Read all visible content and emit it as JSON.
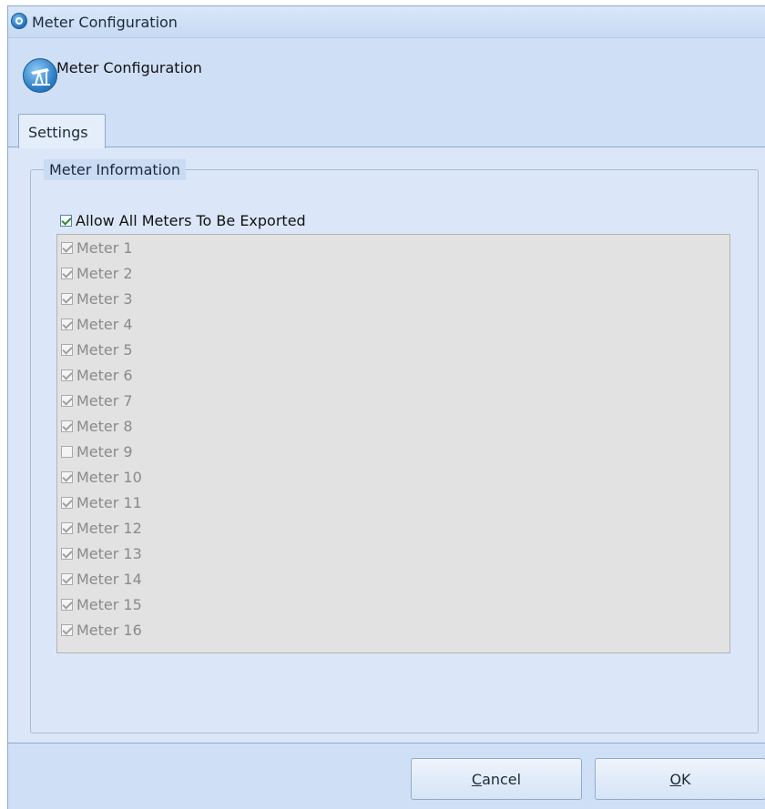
{
  "window": {
    "title": "Meter Configuration"
  },
  "header": {
    "title": "Meter Configuration",
    "icon": "pumpjack-icon"
  },
  "tabs": [
    {
      "label": "Settings",
      "active": true
    }
  ],
  "group": {
    "legend": "Meter Information",
    "allow_all": {
      "label": "Allow All Meters To Be Exported",
      "checked": true
    },
    "meters": [
      {
        "label": "Meter 1",
        "checked": true
      },
      {
        "label": "Meter 2",
        "checked": true
      },
      {
        "label": "Meter 3",
        "checked": true
      },
      {
        "label": "Meter 4",
        "checked": true
      },
      {
        "label": "Meter 5",
        "checked": true
      },
      {
        "label": "Meter 6",
        "checked": true
      },
      {
        "label": "Meter 7",
        "checked": true
      },
      {
        "label": "Meter 8",
        "checked": true
      },
      {
        "label": "Meter 9",
        "checked": false
      },
      {
        "label": "Meter 10",
        "checked": true
      },
      {
        "label": "Meter 11",
        "checked": true
      },
      {
        "label": "Meter 12",
        "checked": true
      },
      {
        "label": "Meter 13",
        "checked": true
      },
      {
        "label": "Meter 14",
        "checked": true
      },
      {
        "label": "Meter 15",
        "checked": true
      },
      {
        "label": "Meter 16",
        "checked": true
      }
    ],
    "meters_enabled": false
  },
  "buttons": {
    "cancel": {
      "mnemonic": "C",
      "rest": "ancel"
    },
    "ok": {
      "mnemonic": "O",
      "rest": "K"
    }
  },
  "colors": {
    "checkmark": "#2e8b2e",
    "disabled_text": "#8a8a8a",
    "accent": "#2a7cc4"
  }
}
